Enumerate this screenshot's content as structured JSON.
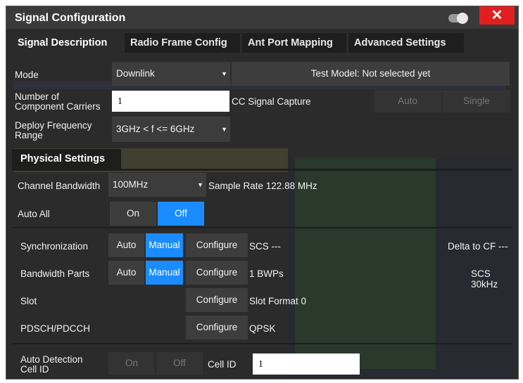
{
  "window": {
    "title": "Signal Configuration",
    "close_symbol": "✕"
  },
  "tabs": [
    {
      "label": "Signal Description"
    },
    {
      "label": "Radio Frame Config"
    },
    {
      "label": "Ant Port Mapping"
    },
    {
      "label": "Advanced Settings"
    }
  ],
  "mode": {
    "label": "Mode",
    "value": "Downlink",
    "test_model": "Test Model: Not selected yet"
  },
  "carriers": {
    "label_line1": "Number of",
    "label_line2": "Component Carriers",
    "value": "1"
  },
  "cc_capture": {
    "label": "CC Signal Capture",
    "auto": "Auto",
    "single": "Single"
  },
  "deploy": {
    "label_line1": "Deploy Frequency",
    "label_line2": "Range",
    "value": "3GHz < f <= 6GHz"
  },
  "physical": {
    "title": "Physical Settings",
    "channel_bw_label": "Channel Bandwidth",
    "channel_bw_value": "100MHz",
    "sample_rate": "Sample Rate 122.88 MHz",
    "auto_all_label": "Auto All",
    "on": "On",
    "off": "Off"
  },
  "rows": {
    "sync": {
      "label": "Synchronization",
      "auto": "Auto",
      "manual": "Manual",
      "configure": "Configure",
      "info": "SCS ---",
      "right": "Delta to CF ---"
    },
    "bwp": {
      "label": "Bandwidth Parts",
      "auto": "Auto",
      "manual": "Manual",
      "configure": "Configure",
      "info": "1 BWPs",
      "right": "SCS 30kHz"
    },
    "slot": {
      "label": "Slot",
      "configure": "Configure",
      "info": "Slot Format 0"
    },
    "pdsch": {
      "label": "PDSCH/PDCCH",
      "configure": "Configure",
      "info": "QPSK"
    }
  },
  "autodetect": {
    "label_line1": "Auto Detection",
    "label_line2": "Cell ID",
    "on": "On",
    "off": "Off",
    "cell_id_label": "Cell ID",
    "cell_id_value": "1"
  },
  "colors": {
    "accent": "#1a8cff",
    "close": "#e02020",
    "panel": "#2b2b2b"
  }
}
